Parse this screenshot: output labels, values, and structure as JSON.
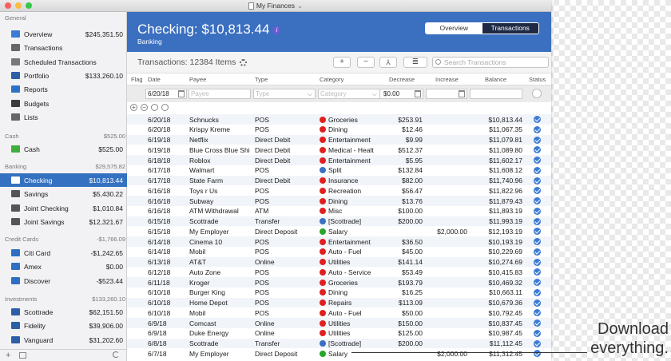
{
  "window": {
    "title": "My Finances",
    "title_chevron": "⌄"
  },
  "sidebar": {
    "general_header": "General",
    "general": [
      {
        "label": "Overview",
        "amount": "$245,351.50",
        "icon": "overview-icon",
        "color": "#3a7bd5"
      },
      {
        "label": "Transactions",
        "amount": "",
        "icon": "transactions-icon",
        "color": "#666"
      },
      {
        "label": "Scheduled Transactions",
        "amount": "",
        "icon": "calendar-icon",
        "color": "#777"
      },
      {
        "label": "Portfolio",
        "amount": "$133,260.10",
        "icon": "portfolio-icon",
        "color": "#2d5fa8"
      },
      {
        "label": "Reports",
        "amount": "",
        "icon": "reports-icon",
        "color": "#2d72c4"
      },
      {
        "label": "Budgets",
        "amount": "",
        "icon": "budgets-icon",
        "color": "#3c3c3c"
      },
      {
        "label": "Lists",
        "amount": "",
        "icon": "lists-icon",
        "color": "#666"
      }
    ],
    "cash_header": "Cash",
    "cash_total": "$525.00",
    "cash": [
      {
        "label": "Cash",
        "amount": "$525.00",
        "icon": "cash-icon",
        "color": "#3fae3f"
      }
    ],
    "banking_header": "Banking",
    "banking_total": "$29,575.82",
    "banking": [
      {
        "label": "Checking",
        "amount": "$10,813.44",
        "icon": "bank-icon",
        "color": "#fff"
      },
      {
        "label": "Savings",
        "amount": "$5,430.22",
        "icon": "bank-icon",
        "color": "#555"
      },
      {
        "label": "Joint Checking",
        "amount": "$1,010.84",
        "icon": "bank-icon",
        "color": "#555"
      },
      {
        "label": "Joint Savings",
        "amount": "$12,321.67",
        "icon": "bank-icon",
        "color": "#555"
      }
    ],
    "credit_header": "Credit Cards",
    "credit_total": "-$1,766.09",
    "credit": [
      {
        "label": "Citi Card",
        "amount": "-$1,242.65",
        "icon": "credit-card-icon",
        "color": "#2e6fc2"
      },
      {
        "label": "Amex",
        "amount": "$0.00",
        "icon": "credit-card-icon",
        "color": "#2e6fc2"
      },
      {
        "label": "Discover",
        "amount": "-$523.44",
        "icon": "credit-card-icon",
        "color": "#2e6fc2"
      }
    ],
    "investments_header": "Investments",
    "investments_total": "$133,260.10",
    "investments": [
      {
        "label": "Scottrade",
        "amount": "$62,151.50",
        "icon": "investment-icon",
        "color": "#2d5fa8"
      },
      {
        "label": "Fidelity",
        "amount": "$39,906.00",
        "icon": "investment-icon",
        "color": "#2d5fa8"
      },
      {
        "label": "Vanguard",
        "amount": "$31,202.60",
        "icon": "investment-icon",
        "color": "#2d5fa8"
      }
    ]
  },
  "account": {
    "title": "Checking: $10,813.44",
    "subtitle": "Banking",
    "info": "i"
  },
  "view_toggle": {
    "overview": "Overview",
    "transactions": "Transactions"
  },
  "toolbar": {
    "count": "Transactions: 12384 Items",
    "add": "+",
    "remove": "−",
    "split": "⅄",
    "list": "≣",
    "search_placeholder": "Search Transactions"
  },
  "columns": {
    "flag": "Flag",
    "date": "Date",
    "payee": "Payee",
    "type": "Type",
    "category": "Category",
    "decrease": "Decrease",
    "increase": "Increase",
    "balance": "Balance",
    "status": "Status"
  },
  "filter": {
    "date": "6/20/18",
    "payee_ph": "Payee",
    "type_ph": "Type",
    "category_ph": "Category",
    "decrease": "$0.00"
  },
  "transactions": [
    {
      "date": "6/20/18",
      "payee": "Schnucks",
      "type": "POS",
      "category": "Groceries",
      "cat_color": "#e02020",
      "decrease": "$253.91",
      "increase": "",
      "balance": "$10,813.44"
    },
    {
      "date": "6/20/18",
      "payee": "Krispy Kreme",
      "type": "POS",
      "category": "Dining",
      "cat_color": "#e02020",
      "decrease": "$12.46",
      "increase": "",
      "balance": "$11,067.35"
    },
    {
      "date": "6/19/18",
      "payee": "Netflix",
      "type": "Direct Debit",
      "category": "Entertainment",
      "cat_color": "#e02020",
      "decrease": "$9.99",
      "increase": "",
      "balance": "$11,079.81"
    },
    {
      "date": "6/19/18",
      "payee": "Blue Cross Blue Shi",
      "type": "Direct Debit",
      "category": "Medical - Healt",
      "cat_color": "#e02020",
      "decrease": "$512.37",
      "increase": "",
      "balance": "$11,089.80"
    },
    {
      "date": "6/18/18",
      "payee": "Roblox",
      "type": "Direct Debit",
      "category": "Entertainment",
      "cat_color": "#e02020",
      "decrease": "$5.95",
      "increase": "",
      "balance": "$11,602.17"
    },
    {
      "date": "6/17/18",
      "payee": "Walmart",
      "type": "POS",
      "category": "Split",
      "cat_color": "#3a6fc4",
      "decrease": "$132.84",
      "increase": "",
      "balance": "$11,608.12"
    },
    {
      "date": "6/17/18",
      "payee": "State Farm",
      "type": "Direct Debit",
      "category": "Insurance",
      "cat_color": "#e02020",
      "decrease": "$82.00",
      "increase": "",
      "balance": "$11,740.96"
    },
    {
      "date": "6/16/18",
      "payee": "Toys r Us",
      "type": "POS",
      "category": "Recreation",
      "cat_color": "#e02020",
      "decrease": "$56.47",
      "increase": "",
      "balance": "$11,822.96"
    },
    {
      "date": "6/16/18",
      "payee": "Subway",
      "type": "POS",
      "category": "Dining",
      "cat_color": "#e02020",
      "decrease": "$13.76",
      "increase": "",
      "balance": "$11,879.43"
    },
    {
      "date": "6/16/18",
      "payee": "ATM Withdrawal",
      "type": "ATM",
      "category": "Misc",
      "cat_color": "#e02020",
      "decrease": "$100.00",
      "increase": "",
      "balance": "$11,893.19"
    },
    {
      "date": "6/15/18",
      "payee": "Scottrade",
      "type": "Transfer",
      "category": "[Scottrade]",
      "cat_color": "#3a6fc4",
      "decrease": "$200.00",
      "increase": "",
      "balance": "$11,993.19"
    },
    {
      "date": "6/15/18",
      "payee": "My Employer",
      "type": "Direct Deposit",
      "category": "Salary",
      "cat_color": "#28a428",
      "decrease": "",
      "increase": "$2,000.00",
      "balance": "$12,193.19"
    },
    {
      "date": "6/14/18",
      "payee": "Cinema 10",
      "type": "POS",
      "category": "Entertainment",
      "cat_color": "#e02020",
      "decrease": "$36.50",
      "increase": "",
      "balance": "$10,193.19"
    },
    {
      "date": "6/14/18",
      "payee": "Mobil",
      "type": "POS",
      "category": "Auto - Fuel",
      "cat_color": "#e02020",
      "decrease": "$45.00",
      "increase": "",
      "balance": "$10,229.69"
    },
    {
      "date": "6/13/18",
      "payee": "AT&T",
      "type": "Online",
      "category": "Utilities",
      "cat_color": "#e02020",
      "decrease": "$141.14",
      "increase": "",
      "balance": "$10,274.69"
    },
    {
      "date": "6/12/18",
      "payee": "Auto Zone",
      "type": "POS",
      "category": "Auto - Service",
      "cat_color": "#e02020",
      "decrease": "$53.49",
      "increase": "",
      "balance": "$10,415.83"
    },
    {
      "date": "6/11/18",
      "payee": "Kroger",
      "type": "POS",
      "category": "Groceries",
      "cat_color": "#e02020",
      "decrease": "$193.79",
      "increase": "",
      "balance": "$10,469.32"
    },
    {
      "date": "6/10/18",
      "payee": "Burger King",
      "type": "POS",
      "category": "Dining",
      "cat_color": "#e02020",
      "decrease": "$16.25",
      "increase": "",
      "balance": "$10,663.11"
    },
    {
      "date": "6/10/18",
      "payee": "Home Depot",
      "type": "POS",
      "category": "Repairs",
      "cat_color": "#e02020",
      "decrease": "$113.09",
      "increase": "",
      "balance": "$10,679.36"
    },
    {
      "date": "6/10/18",
      "payee": "Mobil",
      "type": "POS",
      "category": "Auto - Fuel",
      "cat_color": "#e02020",
      "decrease": "$50.00",
      "increase": "",
      "balance": "$10,792.45"
    },
    {
      "date": "6/9/18",
      "payee": "Comcast",
      "type": "Online",
      "category": "Utilities",
      "cat_color": "#e02020",
      "decrease": "$150.00",
      "increase": "",
      "balance": "$10,837.45"
    },
    {
      "date": "6/9/18",
      "payee": "Duke Energy",
      "type": "Online",
      "category": "Utilities",
      "cat_color": "#e02020",
      "decrease": "$125.00",
      "increase": "",
      "balance": "$10,987.45"
    },
    {
      "date": "6/8/18",
      "payee": "Scottrade",
      "type": "Transfer",
      "category": "[Scottrade]",
      "cat_color": "#3a6fc4",
      "decrease": "$200.00",
      "increase": "",
      "balance": "$11,112.45"
    },
    {
      "date": "6/7/18",
      "payee": "My Employer",
      "type": "Direct Deposit",
      "category": "Salary",
      "cat_color": "#28a428",
      "decrease": "",
      "increase": "$2,000.00",
      "balance": "$11,312.45"
    }
  ],
  "overlay": {
    "line1": "Download",
    "line2": "everything."
  },
  "colors": {
    "accent": "#3b6fc0",
    "selected": "#3471c0",
    "segment_on": "#1e2a44"
  }
}
